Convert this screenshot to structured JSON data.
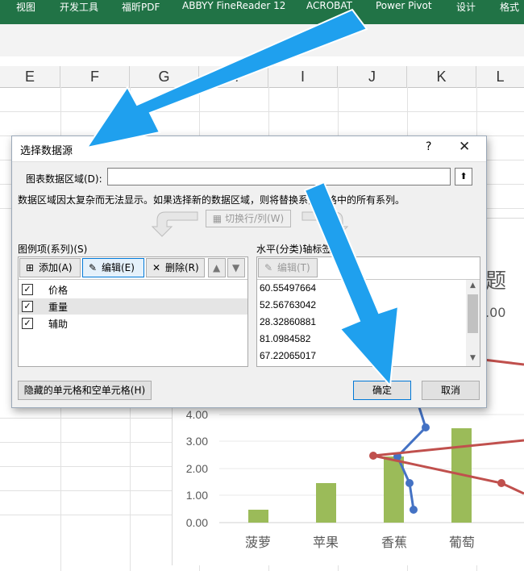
{
  "ribbon": {
    "tabs": [
      "视图",
      "开发工具",
      "福昕PDF",
      "ABBYY FineReader 12",
      "ACROBAT",
      "Power Pivot",
      "设计",
      "格式"
    ]
  },
  "sheet": {
    "columns": [
      "E",
      "F",
      "G",
      "H",
      "I",
      "J",
      "K",
      "L"
    ]
  },
  "chart": {
    "title_fragment": "题",
    "value_fragment": ".00",
    "y_tick_labels": [
      "4.00",
      "3.00",
      "2.00",
      "1.00",
      "0.00"
    ],
    "x_labels": [
      "菠萝",
      "苹果",
      "香蕉",
      "葡萄"
    ]
  },
  "dialog": {
    "title": "选择数据源",
    "help": "?",
    "close": "✕",
    "range_label": "图表数据区域(D):",
    "range_value": "",
    "collapse_icon": "⬆",
    "warning": "数据区域因太复杂而无法显示。如果选择新的数据区域，则将替换系列窗格中的所有系列。",
    "switch_label": "切换行/列(W)",
    "legend_label": "图例项(系列)(S)",
    "add_label": "添加(A)",
    "edit_label": "编辑(E)",
    "remove_label": "删除(R)",
    "axis_label": "水平(分类)轴标签(C)",
    "axis_edit_label": "编辑(T)",
    "series": [
      {
        "name": "价格",
        "checked": true
      },
      {
        "name": "重量",
        "checked": true
      },
      {
        "name": "辅助",
        "checked": true
      }
    ],
    "categories": [
      "60.55497664",
      "52.56763042",
      "28.32860881",
      "81.0984582",
      "67.22065017"
    ],
    "hidden_cells_label": "隐藏的单元格和空单元格(H)",
    "ok_label": "确定",
    "cancel_label": "取消"
  },
  "colors": {
    "excel_green": "#217346",
    "bar_green": "#9bbb59",
    "line_blue": "#4472c4",
    "line_red": "#c0504d",
    "annotation_arrow": "#1fa0ee"
  }
}
